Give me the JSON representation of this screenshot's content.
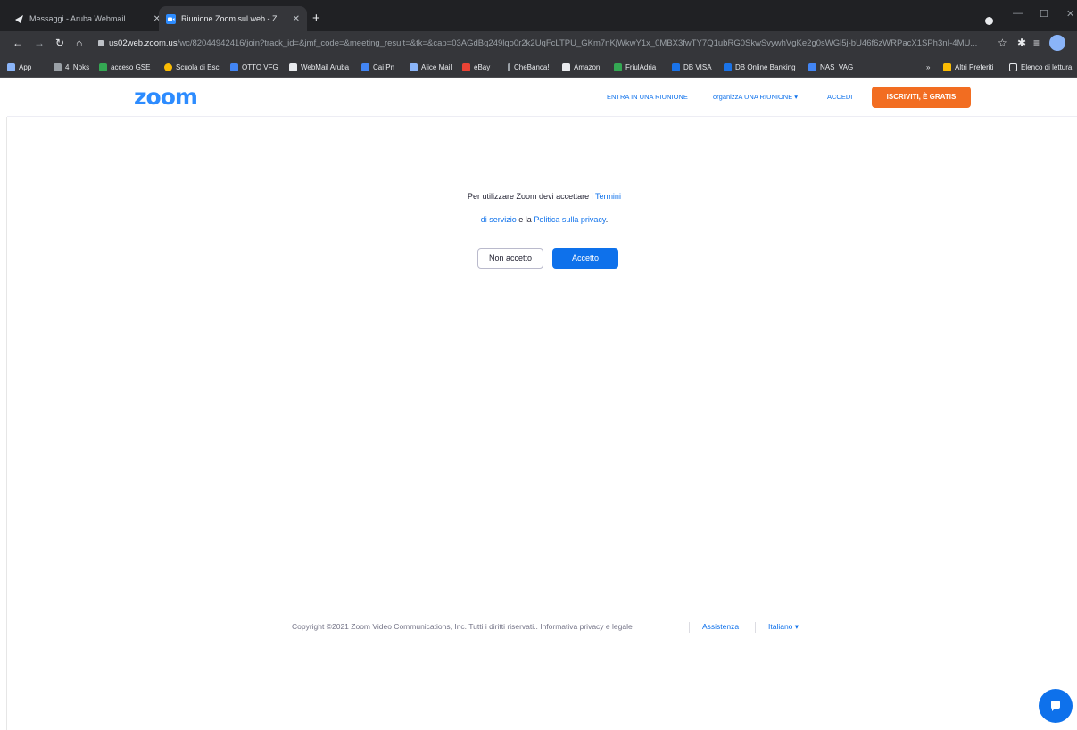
{
  "browser": {
    "tabs": [
      {
        "title": "Messaggi - Aruba Webmail",
        "active": false
      },
      {
        "title": "Riunione Zoom sul web - Zoom",
        "active": true
      }
    ],
    "new_tab": "+",
    "url_host": "us02web.zoom.us",
    "url_rest": "/wc/82044942416/join?track_id=&jmf_code=&meeting_result=&tk=&cap=03AGdBq249lqo0r2k2UqFcLTPU_GKm7nKjWkwY1x_0MBX3fwTY7Q1ubRG0SkwSvywhVgKe2g0sWGl5j-bU46f6zWRPacX1SPh3nI-4MU...",
    "bookmarks": [
      {
        "label": "App",
        "color": "#8ab4f8"
      },
      {
        "label": "4_Noks",
        "color": "#9aa0a6"
      },
      {
        "label": "acceso GSE",
        "color": "#34a853"
      },
      {
        "label": "Scuola di Esc",
        "color": "#fbbc04"
      },
      {
        "label": "OTTO VFG",
        "color": "#4285f4"
      },
      {
        "label": "WebMail Aruba",
        "color": "#e8eaed"
      },
      {
        "label": "Cai Pn",
        "color": "#4285f4"
      },
      {
        "label": "Alice Mail",
        "color": "#8ab4f8"
      },
      {
        "label": "eBay",
        "color": "#ea4335"
      },
      {
        "label": "CheBanca!",
        "color": "#9aa0a6"
      },
      {
        "label": "Amazon",
        "color": "#e8eaed"
      },
      {
        "label": "FriulAdria",
        "color": "#34a853"
      },
      {
        "label": "DB VISA",
        "color": "#1a73e8"
      },
      {
        "label": "DB Online Banking",
        "color": "#1a73e8"
      },
      {
        "label": "NAS_VAG",
        "color": "#4285f4"
      }
    ],
    "bookmarks_overflow": "»",
    "other_bookmarks": "Altri Preferiti",
    "reading_list": "Elenco di lettura"
  },
  "zoom": {
    "logo": "zoom",
    "nav": {
      "join": "ENTRA IN UNA RIUNIONE",
      "host": "organizzA UNA RIUNIONE ▾",
      "signin": "ACCEDI",
      "signup": "ISCRIVITI, È GRATIS"
    },
    "terms": {
      "prefix": "Per utilizzare Zoom devi accettare i ",
      "tos_part1": "Termini",
      "tos_part2": "di servizio",
      "middle": " e la ",
      "privacy": "Politica sulla privacy",
      "suffix": "."
    },
    "decline_label": "Non accetto",
    "accept_label": "Accetto",
    "footer": {
      "copyright": "Copyright ©2021 Zoom Video Communications, Inc. Tutti i diritti riservati.. Informativa privacy e legale",
      "support": "Assistenza",
      "language": "Italiano ▾"
    }
  },
  "colors": {
    "brand_blue": "#0e71eb",
    "signup_orange": "#f26d21"
  }
}
